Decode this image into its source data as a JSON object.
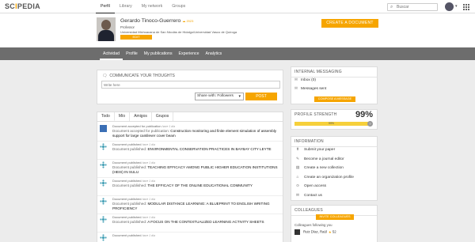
{
  "brand": {
    "logo_pre": "SC",
    "logo_o": "I",
    "logo_post": "PEDIA"
  },
  "topnav": {
    "tabs": [
      {
        "label": "Perfil",
        "active": true
      },
      {
        "label": "Library",
        "active": false
      },
      {
        "label": "My network",
        "active": false
      },
      {
        "label": "Groups",
        "active": false
      }
    ],
    "search_placeholder": "Buscar"
  },
  "profile": {
    "name": "Gerardo Tinoco-Guerrero",
    "badge": "2023",
    "role": "Professor",
    "institution": "Universidad Michoacana de San Nicolás de Hidalgo/Universidad Vasco de Quiroga",
    "edit_label": "EDIT",
    "create_label": "CREATE A DOCUMENT"
  },
  "profile_tabs": [
    {
      "label": "Actividad",
      "active": true
    },
    {
      "label": "Profile",
      "active": false
    },
    {
      "label": "My publications",
      "active": false
    },
    {
      "label": "Experience",
      "active": false
    },
    {
      "label": "Analytics",
      "active": false
    }
  ],
  "communicate": {
    "title": "COMMUNICATE YOUR THOUGHTS",
    "placeholder": "Write here",
    "share_value": "Share with: Followers",
    "post_label": "POST"
  },
  "feed": {
    "tabs": [
      {
        "label": "Todo",
        "active": true
      },
      {
        "label": "Mío",
        "active": false
      },
      {
        "label": "Amigos",
        "active": false
      },
      {
        "label": "Grupos",
        "active": false
      }
    ],
    "items": [
      {
        "header": "Document accepted for publication",
        "time": "hace 1 día",
        "label": "Document accepted for publication:",
        "text": "Construction monitoring and finite element simulation of assembly support for large cantilever cover beam",
        "icon": "avatar"
      },
      {
        "header": "Document published",
        "time": "hace 1 día",
        "label": "Document published:",
        "text": "ENVIRONMENTAL CONSERVATION PRACTICES IN BAYBAY CITY LEYTE",
        "icon": "scipedia"
      },
      {
        "header": "Document published",
        "time": "hace 1 día",
        "label": "Document published:",
        "text": "TEACHING EFFICACY AMONG PUBLIC HIGHER EDUCATION INSTITUTIONS (HEIS) IN SULU",
        "icon": "scipedia"
      },
      {
        "header": "Document published",
        "time": "hace 1 día",
        "label": "Document published:",
        "text": "THE EFFICACY OF THE ONLINE EDUCATIONAL COMMUNITY",
        "icon": "scipedia"
      },
      {
        "header": "Document published",
        "time": "hace 1 día",
        "label": "Document published:",
        "text": "MODULAR DISTANCE LEARNING: A BLUEPRINT TO ENGLISH WRITING PROFICIENCY",
        "icon": "scipedia"
      },
      {
        "header": "Document published",
        "time": "hace 1 día",
        "label": "Document published:",
        "text": "A FOCUS ON THE CONTEXTUALIZED LEARNING ACTIVITY SHEETS",
        "icon": "scipedia"
      },
      {
        "header": "Document published",
        "time": "hace 1 día",
        "label": "",
        "text": "",
        "icon": "scipedia"
      }
    ]
  },
  "messaging": {
    "title": "INTERNAL MESSAGING",
    "inbox": "Inbox (0)",
    "sent": "Messages sent",
    "compose": "COMPOSE A MESSAGE"
  },
  "strength": {
    "title": "PROFILE STRENGTH",
    "percent_text": "99%",
    "value": 99,
    "bar_text": "99%"
  },
  "information": {
    "title": "INFORMATION",
    "items": [
      {
        "label": "Submit your paper",
        "icon": "upload-icon"
      },
      {
        "label": "Become a journal editor",
        "icon": "journal-icon"
      },
      {
        "label": "Create a new collection",
        "icon": "collection-icon"
      },
      {
        "label": "Create an organization profile",
        "icon": "organization-icon"
      },
      {
        "label": "Open access",
        "icon": "open-access-icon"
      },
      {
        "label": "Contact us",
        "icon": "mail-icon"
      }
    ]
  },
  "colleagues": {
    "title": "COLLEAGUES",
    "invite": "INVITE COLLEAGUES",
    "following_label": "Colleagues following you",
    "follower_name": "Ruiz Díaz, Raúl",
    "follower_score": "52"
  },
  "colors": {
    "accent": "#f6a500",
    "band": "#6d6d6d",
    "bar": "#f6d03a"
  }
}
